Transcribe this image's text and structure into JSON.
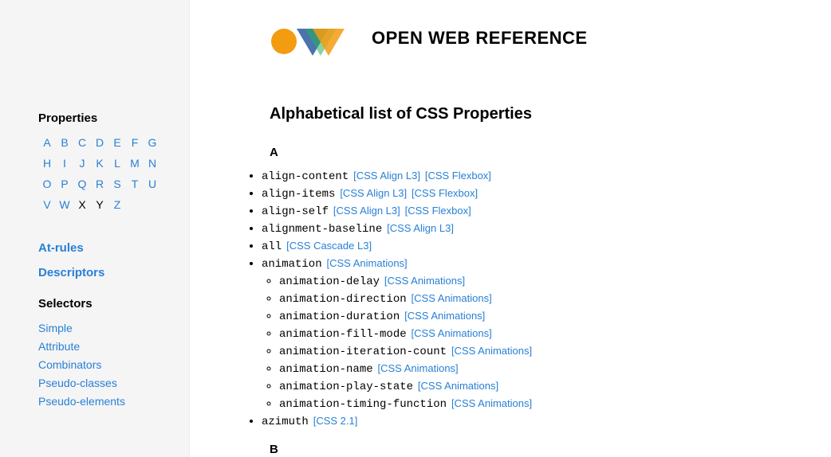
{
  "header": {
    "title": "OPEN WEB REFERENCE"
  },
  "sidebar": {
    "properties_heading": "Properties",
    "letters": [
      "A",
      "B",
      "C",
      "D",
      "E",
      "F",
      "G",
      "H",
      "I",
      "J",
      "K",
      "L",
      "M",
      "N",
      "O",
      "P",
      "Q",
      "R",
      "S",
      "T",
      "U",
      "V",
      "W",
      "X",
      "Y",
      "Z"
    ],
    "disabled_letters": [
      "X",
      "Y"
    ],
    "at_rules": "At-rules",
    "descriptors": "Descriptors",
    "selectors_heading": "Selectors",
    "selector_links": [
      "Simple",
      "Attribute",
      "Combinators",
      "Pseudo-classes",
      "Pseudo-elements"
    ]
  },
  "content": {
    "heading": "Alphabetical list of CSS Properties",
    "letter_a": "A",
    "letter_b": "B",
    "props_a": [
      {
        "name": "align-content",
        "specs": [
          "[CSS Align L3]",
          "[CSS Flexbox]"
        ]
      },
      {
        "name": "align-items",
        "specs": [
          "[CSS Align L3]",
          "[CSS Flexbox]"
        ]
      },
      {
        "name": "align-self",
        "specs": [
          "[CSS Align L3]",
          "[CSS Flexbox]"
        ]
      },
      {
        "name": "alignment-baseline",
        "specs": [
          "[CSS Align L3]"
        ]
      },
      {
        "name": "all",
        "specs": [
          "[CSS Cascade L3]"
        ]
      },
      {
        "name": "animation",
        "specs": [
          "[CSS Animations]"
        ],
        "children": [
          {
            "name": "animation-delay",
            "specs": [
              "[CSS Animations]"
            ]
          },
          {
            "name": "animation-direction",
            "specs": [
              "[CSS Animations]"
            ]
          },
          {
            "name": "animation-duration",
            "specs": [
              "[CSS Animations]"
            ]
          },
          {
            "name": "animation-fill-mode",
            "specs": [
              "[CSS Animations]"
            ]
          },
          {
            "name": "animation-iteration-count",
            "specs": [
              "[CSS Animations]"
            ]
          },
          {
            "name": "animation-name",
            "specs": [
              "[CSS Animations]"
            ]
          },
          {
            "name": "animation-play-state",
            "specs": [
              "[CSS Animations]"
            ]
          },
          {
            "name": "animation-timing-function",
            "specs": [
              "[CSS Animations]"
            ]
          }
        ]
      },
      {
        "name": "azimuth",
        "specs": [
          "[CSS 2.1]"
        ]
      }
    ]
  }
}
